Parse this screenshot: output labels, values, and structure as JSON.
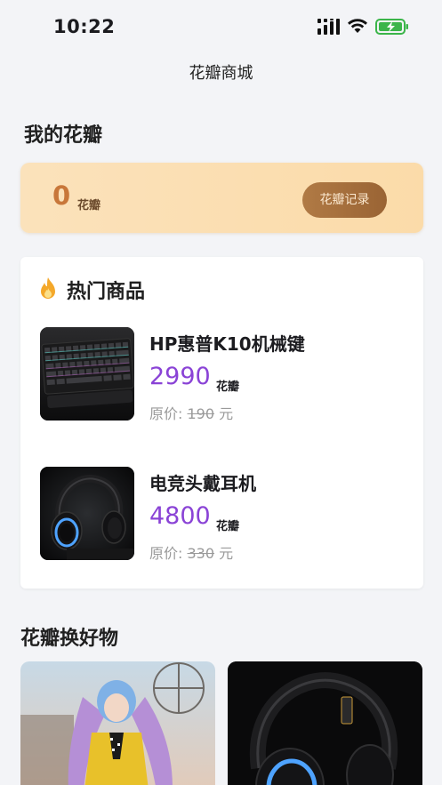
{
  "status_bar": {
    "time": "10:22",
    "icons": [
      "signal-icon",
      "wifi-icon",
      "battery-charging-icon"
    ]
  },
  "nav": {
    "title": "花瓣商城"
  },
  "my_petals": {
    "section_title": "我的花瓣",
    "count": "0",
    "unit": "花瓣",
    "records_button": "花瓣记录"
  },
  "hot": {
    "title": "热门商品",
    "icon": "fire-icon",
    "products": [
      {
        "name": "HP惠普K10机械键",
        "price": "2990",
        "price_unit": "花瓣",
        "orig_label": "原价:",
        "orig_price": "190",
        "orig_unit": "元",
        "image": "keyboard-image"
      },
      {
        "name": "电竞头戴耳机",
        "price": "4800",
        "price_unit": "花瓣",
        "orig_label": "原价:",
        "orig_price": "330",
        "orig_unit": "元",
        "image": "headset-image"
      }
    ]
  },
  "exchange": {
    "section_title": "花瓣换好物",
    "tiles": [
      "cosplay-figure-image",
      "headset-image"
    ]
  },
  "colors": {
    "accent_purple": "#8a43d6",
    "petal_orange": "#c8773a",
    "card_gradient": "#fbdba9",
    "button_brown": "#a36d3b"
  }
}
